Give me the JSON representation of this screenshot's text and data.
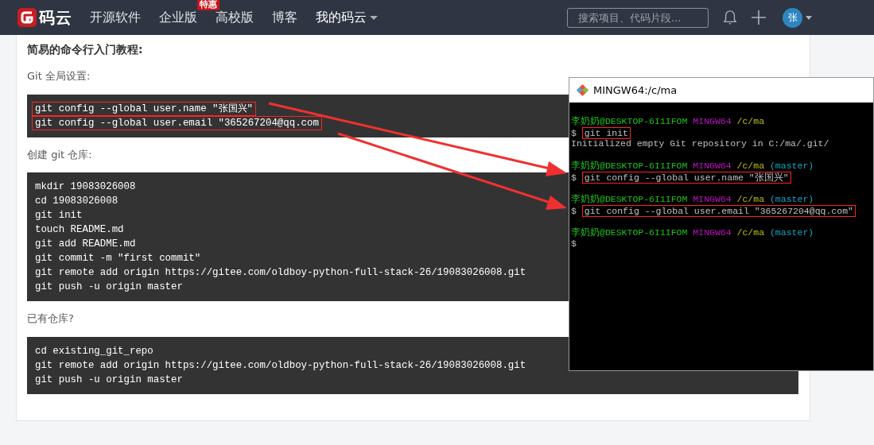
{
  "navbar": {
    "logo_text": "码云",
    "items": [
      {
        "label": "开源软件",
        "dropdown": false
      },
      {
        "label": "企业版",
        "badge": "特惠",
        "dropdown": false
      },
      {
        "label": "高校版",
        "dropdown": false
      },
      {
        "label": "博客",
        "dropdown": false
      },
      {
        "label": "我的码云",
        "dropdown": true
      }
    ],
    "search": {
      "placeholder": "搜索项目、代码片段..."
    },
    "avatar": "张"
  },
  "content": {
    "heading": "简易的命令行入门教程:",
    "sections": [
      {
        "label": "Git 全局设置:",
        "lines": [
          {
            "text": "git config --global user.name \"张国兴\"",
            "highlighted": true
          },
          {
            "text": "git config --global user.email \"365267204@qq.com",
            "highlighted": true
          }
        ]
      },
      {
        "label": "创建 git 仓库:",
        "lines": [
          {
            "text": "mkdir 19083026008",
            "highlighted": false
          },
          {
            "text": "cd 19083026008",
            "highlighted": false
          },
          {
            "text": "git init",
            "highlighted": false
          },
          {
            "text": "touch README.md",
            "highlighted": false
          },
          {
            "text": "git add README.md",
            "highlighted": false
          },
          {
            "text": "git commit -m \"first commit\"",
            "highlighted": false
          },
          {
            "text": "git remote add origin https://gitee.com/oldboy-python-full-stack-26/19083026008.git",
            "highlighted": false
          },
          {
            "text": "git push -u origin master",
            "highlighted": false
          }
        ]
      },
      {
        "label": "已有仓库?",
        "lines": [
          {
            "text": "cd existing_git_repo",
            "highlighted": false
          },
          {
            "text": "git remote add origin https://gitee.com/oldboy-python-full-stack-26/19083026008.git",
            "highlighted": false
          },
          {
            "text": "git push -u origin master",
            "highlighted": false
          }
        ]
      }
    ]
  },
  "terminal": {
    "title": "MINGW64:/c/ma",
    "lines": [
      {
        "kind": "blank"
      },
      {
        "kind": "prompt",
        "user": "李奶奶@DESKTOP-6I1IFOM",
        "shell": "MINGW64",
        "path": "/c/ma"
      },
      {
        "kind": "command",
        "symbol": "$",
        "text": "git init",
        "highlighted": true
      },
      {
        "kind": "output",
        "text": "Initialized empty Git repository in C:/ma/.git/"
      },
      {
        "kind": "blank"
      },
      {
        "kind": "prompt",
        "user": "李奶奶@DESKTOP-6I1IFOM",
        "shell": "MINGW64",
        "path": "/c/ma",
        "branch": "(master)"
      },
      {
        "kind": "command",
        "symbol": "$",
        "text": "git config --global user.name \"张国兴\"",
        "highlighted": true
      },
      {
        "kind": "blank"
      },
      {
        "kind": "prompt",
        "user": "李奶奶@DESKTOP-6I1IFOM",
        "shell": "MINGW64",
        "path": "/c/ma",
        "branch": "(master)"
      },
      {
        "kind": "command",
        "symbol": "$",
        "text": "git config --global user.email \"365267204@qq.com\"",
        "highlighted": true
      },
      {
        "kind": "blank"
      },
      {
        "kind": "prompt",
        "user": "李奶奶@DESKTOP-6I1IFOM",
        "shell": "MINGW64",
        "path": "/c/ma",
        "branch": "(master)"
      },
      {
        "kind": "command",
        "symbol": "$"
      }
    ]
  }
}
